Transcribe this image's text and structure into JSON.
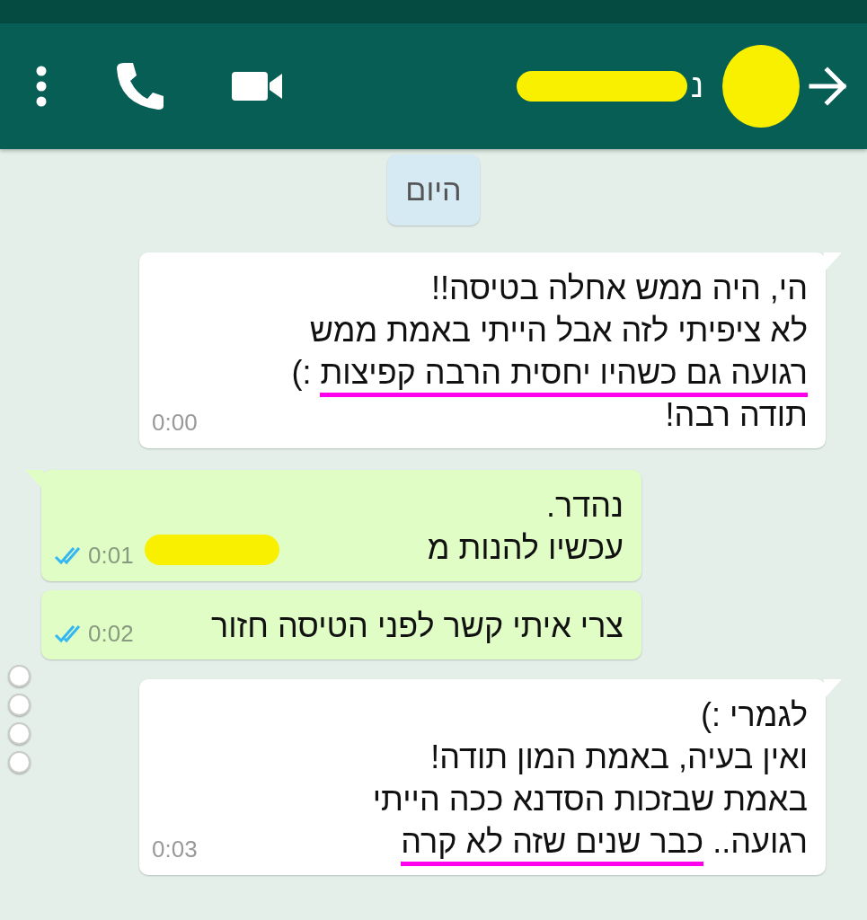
{
  "header": {
    "contact_name": "נ",
    "name_redacted": true,
    "avatar_redacted": true
  },
  "date_chip": "היום",
  "messages": [
    {
      "kind": "incoming",
      "time": "0:00",
      "lines": [
        [
          {
            "text": "הי, היה ממש אחלה בטיסה!!",
            "underlined": false
          }
        ],
        [
          {
            "text": "לא ציפיתי לזה אבל הייתי באמת ממש",
            "underlined": false
          }
        ],
        [
          {
            "text": "רגועה גם כשהיו יחסית הרבה קפיצות",
            "underlined": true
          },
          {
            "text": " :)",
            "underlined": false
          }
        ],
        [
          {
            "text": "תודה רבה!",
            "underlined": false
          }
        ]
      ]
    },
    {
      "kind": "outgoing",
      "time": "0:01",
      "read": true,
      "redacted_tail": true,
      "lines": [
        [
          {
            "text": "נהדר.",
            "underlined": false
          }
        ],
        [
          {
            "text": "עכשיו להנות מ",
            "underlined": false
          }
        ]
      ]
    },
    {
      "kind": "outgoing",
      "time": "0:02",
      "read": true,
      "lines": [
        [
          {
            "text": "צרי איתי קשר לפני הטיסה חזור",
            "underlined": false
          }
        ]
      ]
    },
    {
      "kind": "incoming",
      "time": "0:03",
      "lines": [
        [
          {
            "text": "לגמרי :)",
            "underlined": false
          }
        ],
        [
          {
            "text": "ואין בעיה, באמת המון תודה!",
            "underlined": false
          }
        ],
        [
          {
            "text": "באמת שבזכות הסדנא ככה הייתי",
            "underlined": false
          }
        ],
        [
          {
            "text": "רגועה.. ",
            "underlined": false
          },
          {
            "text": "כבר שנים שזה לא קרה",
            "underlined": true
          }
        ]
      ]
    }
  ]
}
